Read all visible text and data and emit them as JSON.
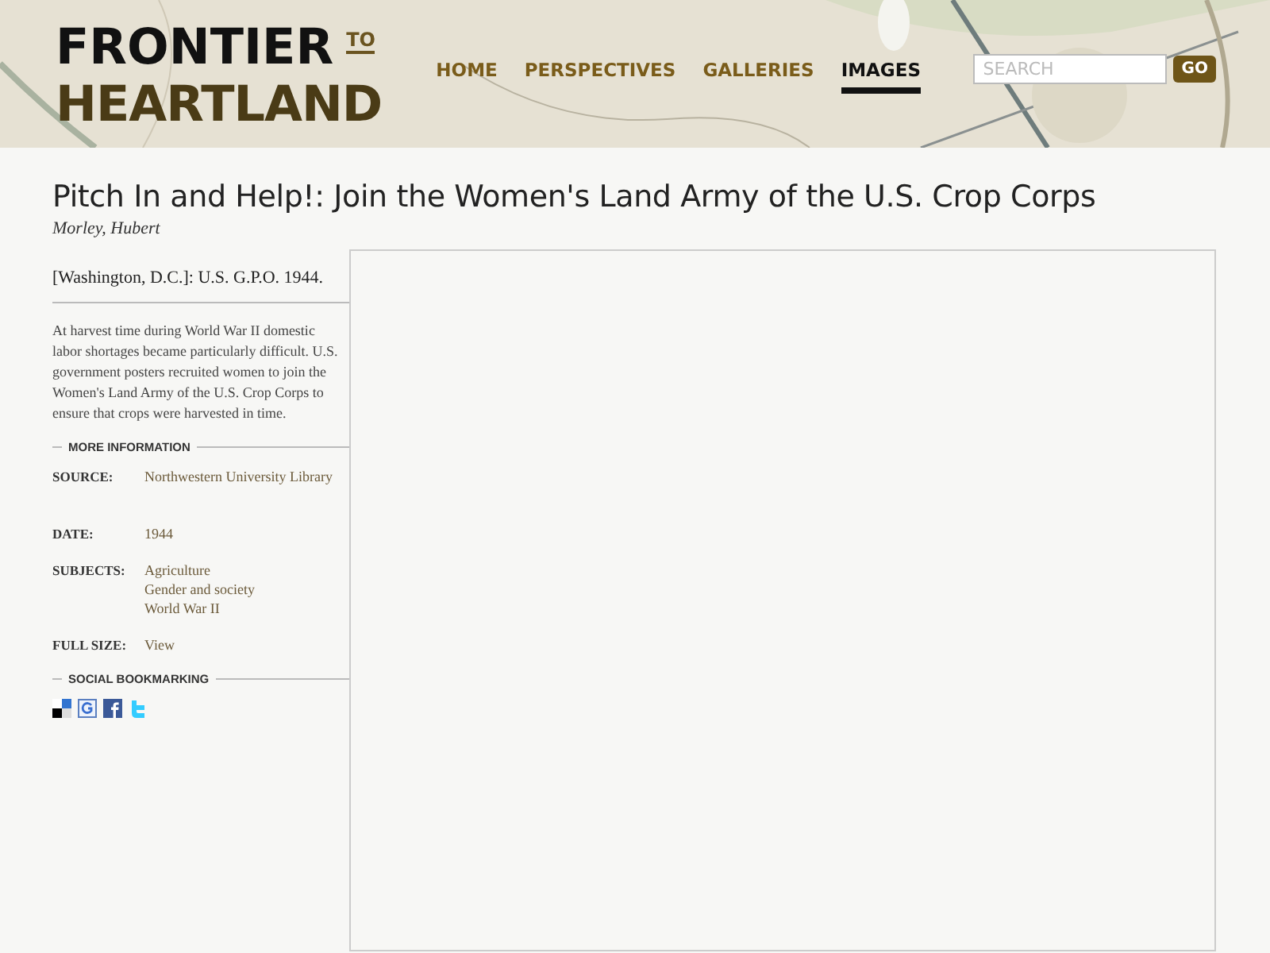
{
  "logo": {
    "line_1": "FRONTIER",
    "to": "TO",
    "line_2": "HEARTLAND"
  },
  "nav": [
    {
      "label": "HOME",
      "selected": false
    },
    {
      "label": "PERSPECTIVES",
      "selected": false
    },
    {
      "label": "GALLERIES",
      "selected": false
    },
    {
      "label": "IMAGES",
      "selected": true
    }
  ],
  "search": {
    "placeholder": "SEARCH",
    "button": "GO"
  },
  "title": "Pitch In and Help!: Join the Women's Land Army of the U.S. Crop Corps",
  "author": "Morley, Hubert",
  "publication": "[Washington, D.C.]: U.S. G.P.O. 1944.",
  "description": "At harvest time during World War II domestic labor shortages became particularly difficult. U.S. government posters recruited women to join the Women's Land Army of the U.S. Crop Corps to ensure that crops were harvested in time.",
  "more_information": {
    "heading": "MORE INFORMATION",
    "fields": [
      {
        "label": "SOURCE:",
        "values": [
          "Northwestern University Library"
        ]
      },
      {
        "label": "DATE:",
        "values": [
          "1944"
        ]
      },
      {
        "label": "SUBJECTS:",
        "values": [
          "Agriculture",
          "Gender and society",
          "World War II"
        ]
      },
      {
        "label": "FULL SIZE:",
        "values": [
          "View"
        ]
      }
    ]
  },
  "social": {
    "heading": "SOCIAL BOOKMARKING",
    "icons": [
      {
        "kind": "delicious"
      },
      {
        "kind": "google"
      },
      {
        "kind": "facebook"
      },
      {
        "kind": "twitter"
      }
    ]
  }
}
